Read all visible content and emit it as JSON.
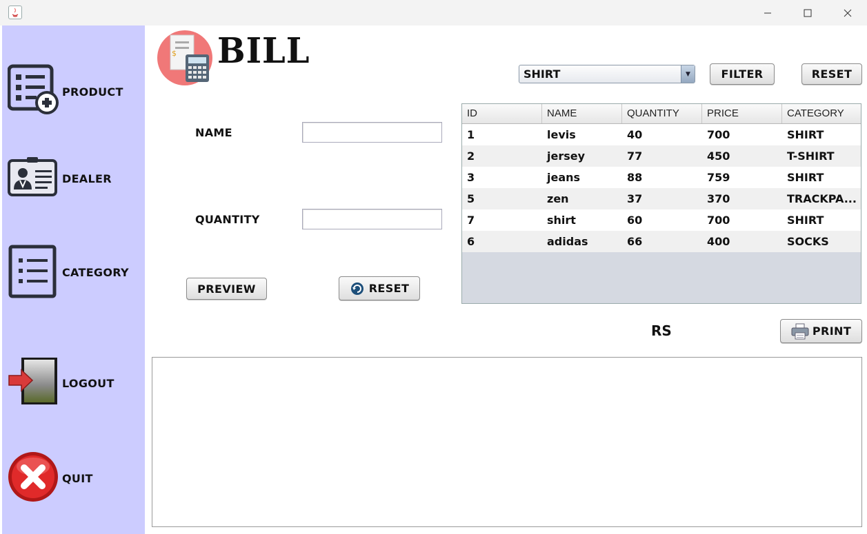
{
  "sidebar": {
    "items": [
      {
        "label": "PRODUCT"
      },
      {
        "label": "DEALER"
      },
      {
        "label": "CATEGORY"
      },
      {
        "label": "LOGOUT"
      },
      {
        "label": "QUIT"
      }
    ]
  },
  "header": {
    "title": "BILL"
  },
  "form": {
    "name_label": "NAME",
    "name_value": "",
    "quantity_label": "QUANTITY",
    "quantity_value": "",
    "preview_label": "PREVIEW",
    "reset_label": "RESET"
  },
  "filter": {
    "selected": "SHIRT",
    "filter_label": "FILTER",
    "reset_label": "RESET"
  },
  "table": {
    "columns": [
      "ID",
      "NAME",
      "QUANTITY",
      "PRICE",
      "CATEGORY"
    ],
    "rows": [
      [
        "1",
        "levis",
        "40",
        "700",
        "SHIRT"
      ],
      [
        "2",
        "jersey",
        "77",
        "450",
        "T-SHIRT"
      ],
      [
        "3",
        "jeans",
        "88",
        "759",
        "SHIRT"
      ],
      [
        "5",
        "zen",
        "37",
        "370",
        "TRACKPA..."
      ],
      [
        "7",
        "shirt",
        "60",
        "700",
        "SHIRT"
      ],
      [
        "6",
        "adidas",
        "66",
        "400",
        "SOCKS"
      ]
    ]
  },
  "total": {
    "label": "RS"
  },
  "print": {
    "label": "PRINT",
    "content": ""
  },
  "colors": {
    "sidebar": "#ccccff",
    "row_alt": "#f0f0f0",
    "table_bg": "#d5d9e1"
  }
}
